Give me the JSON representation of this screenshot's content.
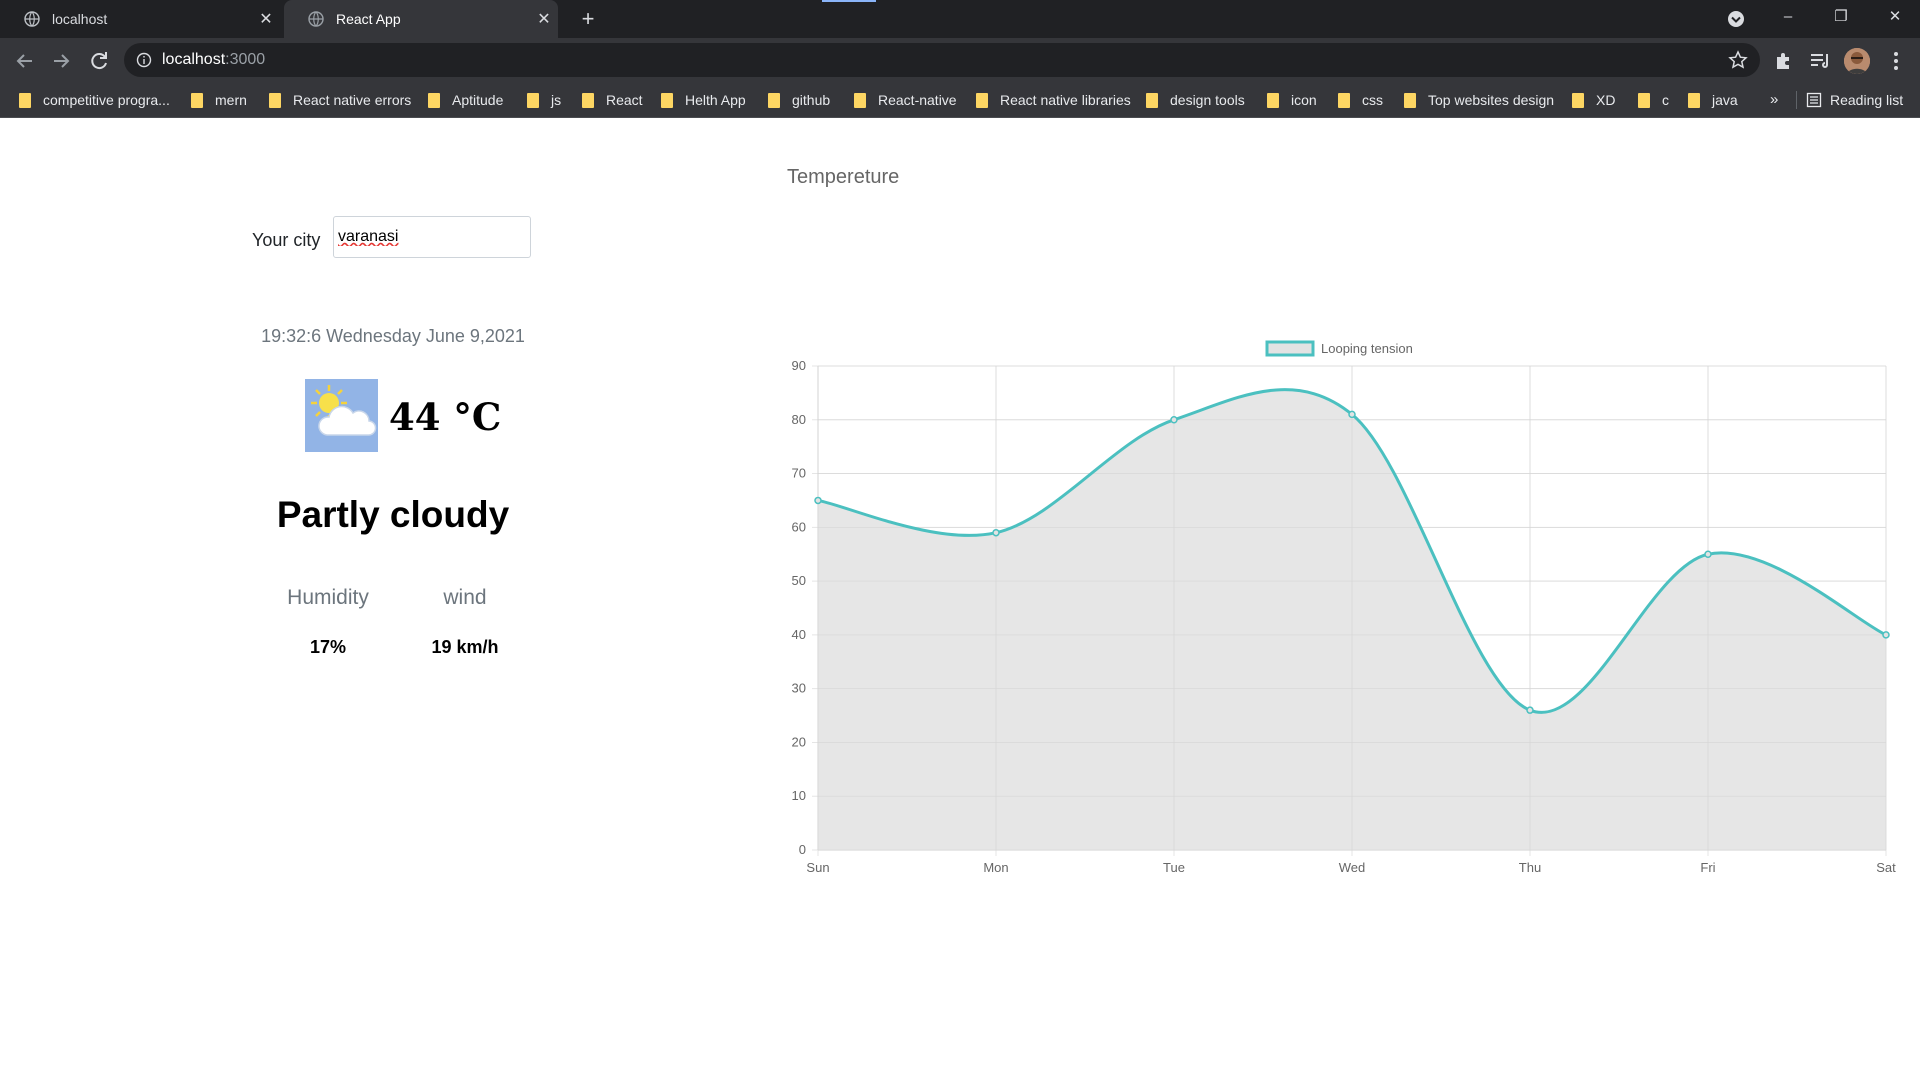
{
  "browser": {
    "tabs": [
      {
        "title": "localhost",
        "close": "✕",
        "active": false
      },
      {
        "title": "React App",
        "close": "✕",
        "active": true
      }
    ],
    "new_tab": "+",
    "window_controls": [
      "–",
      "❐",
      "✕"
    ],
    "address": {
      "host": "localhost",
      "port": ":3000"
    },
    "bookmarks": [
      "competitive progra...",
      "mern",
      "React native errors",
      "Aptitude",
      "js",
      "React",
      "Helth App",
      "github",
      "React-native",
      "React native libraries",
      "design tools",
      "icon",
      "css",
      "Top websites design",
      "XD",
      "c",
      "java"
    ],
    "bookmarks_more": "»",
    "reading_list": "Reading list"
  },
  "weather": {
    "city_label": "Your city",
    "city_value": "varanasi",
    "datetime": "19:32:6 Wednesday June 9,2021",
    "temperature": "44 °C",
    "condition": "Partly cloudy",
    "humidity_label": "Humidity",
    "humidity_value": "17%",
    "wind_label": "wind",
    "wind_value": "19 km/h",
    "icon": "partly-cloudy-icon"
  },
  "chart_title": "Tempereture",
  "chart_data": {
    "type": "area",
    "categories": [
      "Sun",
      "Mon",
      "Tue",
      "Wed",
      "Thu",
      "Fri",
      "Sat"
    ],
    "series": [
      {
        "name": "Looping tension",
        "values": [
          65,
          59,
          80,
          81,
          26,
          55,
          40
        ]
      }
    ],
    "ylim": [
      0,
      90
    ],
    "yticks": [
      0,
      10,
      20,
      30,
      40,
      50,
      60,
      70,
      80,
      90
    ],
    "grid": true,
    "legend": "top",
    "colors": {
      "line": "#4bc0c0",
      "fill": "#e3e3e3",
      "grid": "#e5e5e5",
      "tick": "#666666"
    }
  }
}
